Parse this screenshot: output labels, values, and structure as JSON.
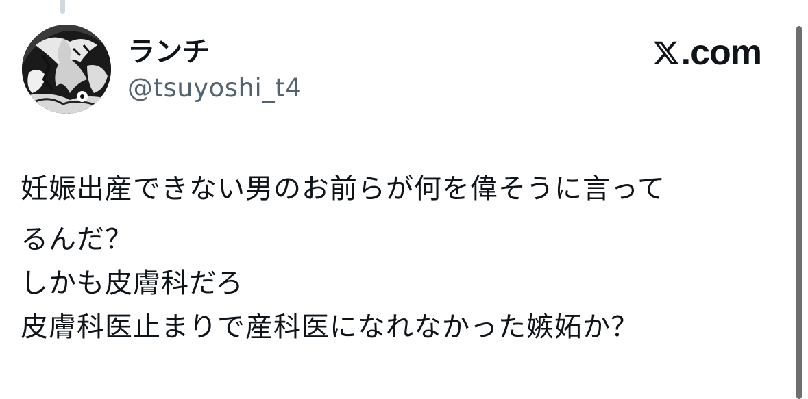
{
  "post": {
    "author_name": "ランチ",
    "author_handle": "@tsuyoshi_t4",
    "brand": ".com",
    "body_lines": [
      "妊娠出産できない男のお前らが何を偉そうに言って",
      "るんだ？",
      "しかも皮膚科だろ",
      "皮膚科医止まりで産科医になれなかった嫉妬か？"
    ]
  },
  "icons": {
    "brand_logo": "x-logo-icon",
    "avatar": "avatar"
  },
  "colors": {
    "text": "#0f1419",
    "handle": "#536471",
    "thread_line": "#cfd9de",
    "scrollbar": "#6e6e6e"
  }
}
